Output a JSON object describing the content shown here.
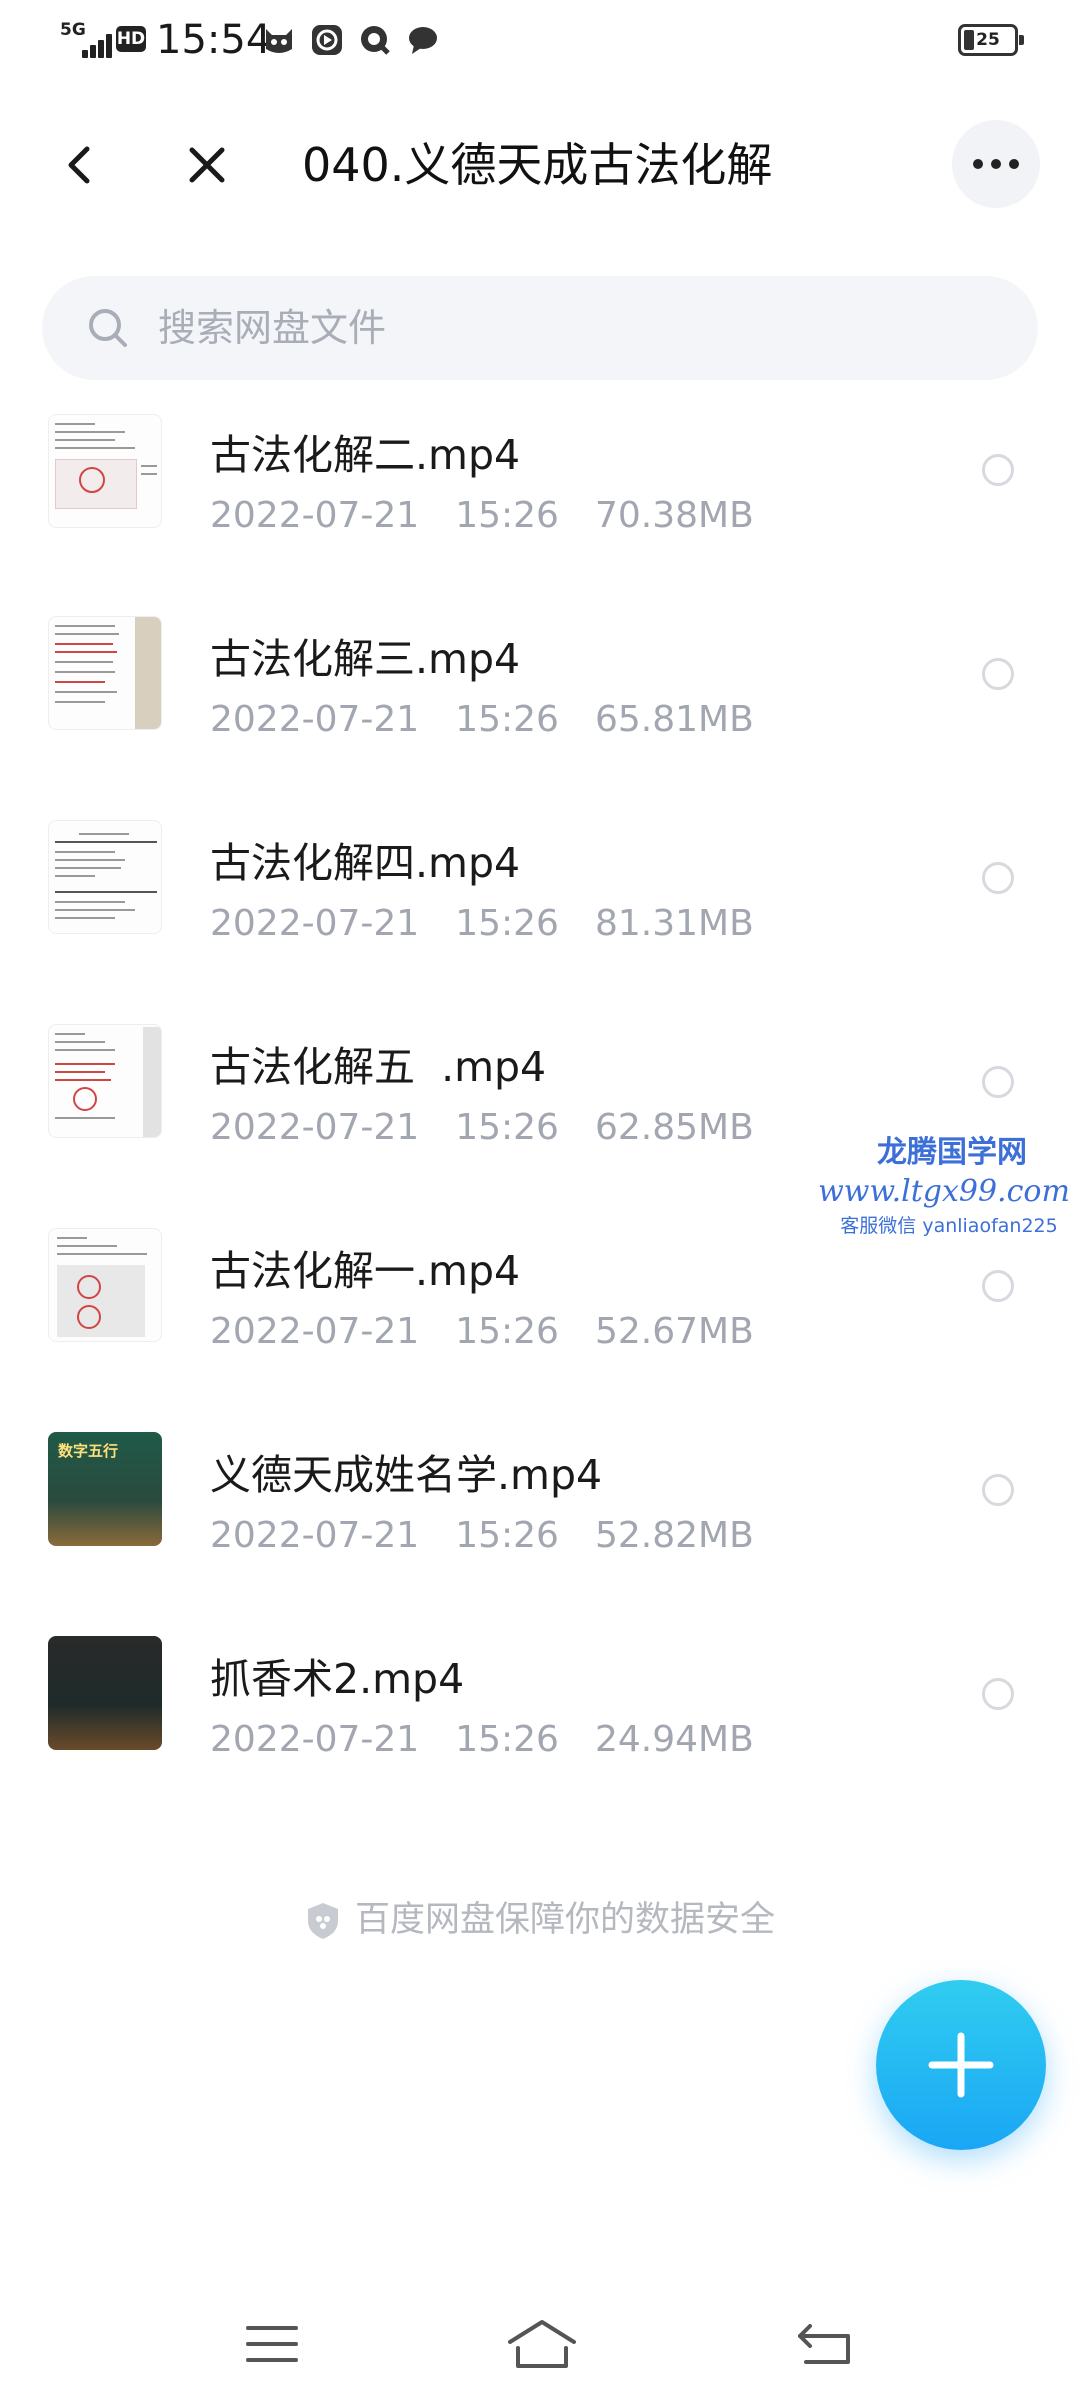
{
  "status_bar": {
    "network": "5G",
    "hd": "HD",
    "time": "15:54",
    "battery": "25",
    "notification_icons": [
      "cat-app-icon",
      "video-app-icon",
      "qq-icon",
      "chat-bubble-icon"
    ]
  },
  "header": {
    "title": "040.义德天成古法化解",
    "back_icon": "back-arrow-icon",
    "close_icon": "close-icon",
    "more_icon": "more-dots-icon"
  },
  "search": {
    "placeholder": "搜索网盘文件"
  },
  "files": [
    {
      "name": "古法化解二.mp4",
      "date": "2022-07-21",
      "time": "15:26",
      "size": "70.38MB",
      "thumb": "document-thumbnail"
    },
    {
      "name": "古法化解三.mp4",
      "date": "2022-07-21",
      "time": "15:26",
      "size": "65.81MB",
      "thumb": "document-thumbnail"
    },
    {
      "name": "古法化解四.mp4",
      "date": "2022-07-21",
      "time": "15:26",
      "size": "81.31MB",
      "thumb": "document-thumbnail"
    },
    {
      "name": "古法化解五  .mp4",
      "date": "2022-07-21",
      "time": "15:26",
      "size": "62.85MB",
      "thumb": "document-thumbnail"
    },
    {
      "name": "古法化解一.mp4",
      "date": "2022-07-21",
      "time": "15:26",
      "size": "52.67MB",
      "thumb": "document-thumbnail"
    },
    {
      "name": "义德天成姓名学.mp4",
      "date": "2022-07-21",
      "time": "15:26",
      "size": "52.82MB",
      "thumb": "slide-thumbnail"
    },
    {
      "name": "抓香术2.mp4",
      "date": "2022-07-21",
      "time": "15:26",
      "size": "24.94MB",
      "thumb": "slide-thumbnail"
    }
  ],
  "thumb_text": {
    "slide_title": "数字五行"
  },
  "watermark": {
    "title": "龙腾国学网",
    "url": "www.ltgx99.com",
    "wechat": "客服微信 yanliaofan225"
  },
  "footer": {
    "security_note": "百度网盘保障你的数据安全"
  },
  "fab": {
    "icon": "plus-icon"
  },
  "nav": {
    "icons": [
      "menu-icon",
      "home-icon",
      "back-icon"
    ]
  },
  "colors": {
    "accent": "#1aa6f5",
    "meta_text": "#a2a6b0",
    "watermark": "#3d6fd8"
  }
}
